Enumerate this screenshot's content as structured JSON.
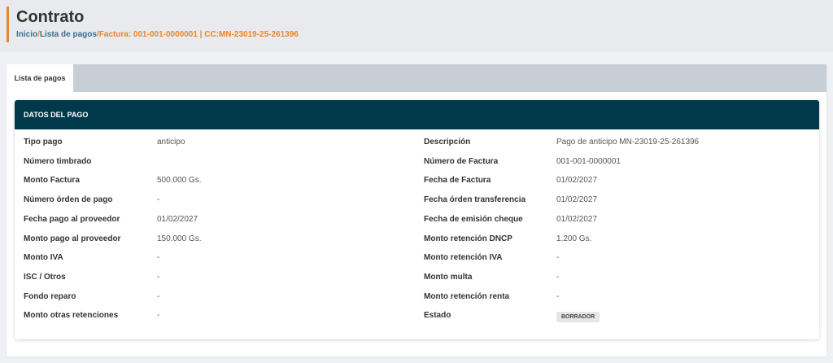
{
  "header": {
    "title": "Contrato",
    "breadcrumb": {
      "home": "Inicio",
      "sep1": "/",
      "list": "Lista de pagos",
      "sep2": "/",
      "current": "Factura: 001-001-0000001 | CC:MN-23019-25-261396"
    }
  },
  "tabs": [
    {
      "label": "Lista de pagos"
    }
  ],
  "card": {
    "title": "DATOS DEL PAGO"
  },
  "left": [
    {
      "label": "Tipo pago",
      "value": "anticipo"
    },
    {
      "label": "Número timbrado",
      "value": ""
    },
    {
      "label": "Monto Factura",
      "value": "500.000 Gs."
    },
    {
      "label": "Número órden de pago",
      "value": "-"
    },
    {
      "label": "Fecha pago al proveedor",
      "value": "01/02/2027"
    },
    {
      "label": "Monto pago al proveedor",
      "value": "150.000 Gs."
    },
    {
      "label": "Monto IVA",
      "value": "-"
    },
    {
      "label": "ISC / Otros",
      "value": "-"
    },
    {
      "label": "Fondo reparo",
      "value": "-"
    },
    {
      "label": "Monto otras retenciones",
      "value": "-"
    }
  ],
  "right": [
    {
      "label": "Descripción",
      "value": "Pago de anticipo MN-23019-25-261396"
    },
    {
      "label": "Número de Factura",
      "value": "001-001-0000001"
    },
    {
      "label": "Fecha de Factura",
      "value": "01/02/2027"
    },
    {
      "label": "Fecha órden transferencia",
      "value": "01/02/2027"
    },
    {
      "label": "Fecha de emisión cheque",
      "value": "01/02/2027"
    },
    {
      "label": "Monto retención DNCP",
      "value": "1.200 Gs."
    },
    {
      "label": "Monto retención IVA",
      "value": "-"
    },
    {
      "label": "Monto multa",
      "value": "-"
    },
    {
      "label": "Monto retención renta",
      "value": "-"
    },
    {
      "label": "Estado",
      "value": "BORRADOR"
    }
  ]
}
